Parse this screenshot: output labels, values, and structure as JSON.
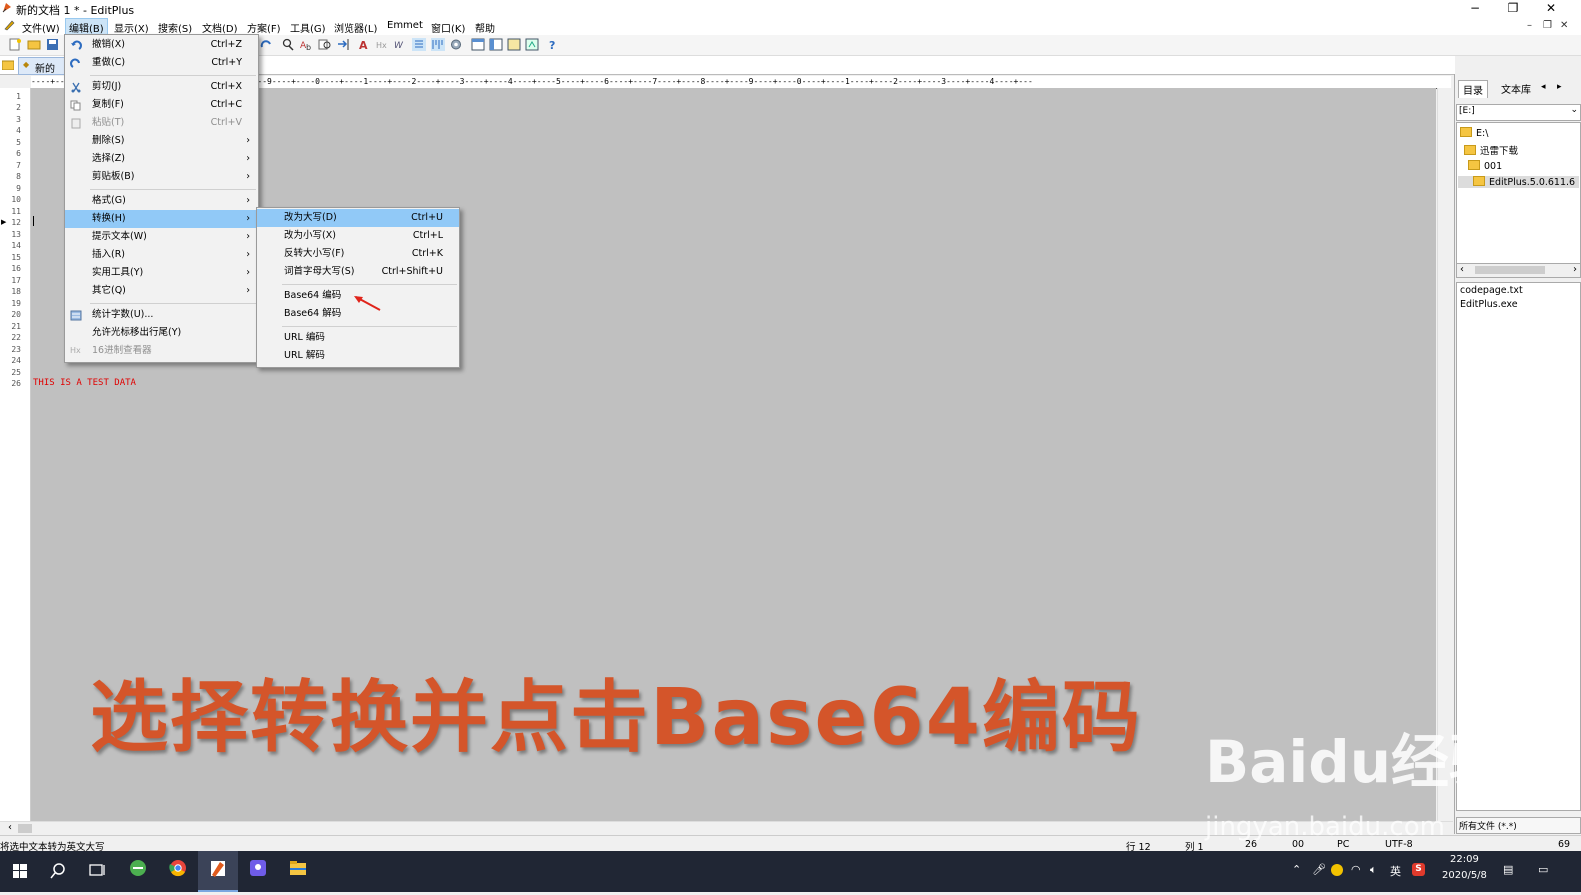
{
  "window": {
    "title": "新的文档 1 * - EditPlus",
    "min": "−",
    "max": "❐",
    "close": "✕"
  },
  "menubar": [
    "文件(W)",
    "编辑(B)",
    "显示(X)",
    "搜索(S)",
    "文档(D)",
    "方案(F)",
    "工具(G)",
    "浏览器(L)",
    "Emmet",
    "窗口(K)",
    "帮助"
  ],
  "mdi": {
    "min": "–",
    "restore": "❐",
    "close": "✕"
  },
  "tabs": [
    {
      "label": "新的"
    }
  ],
  "ruler": "----+----5----+----6----+----7----+----8----+----9----+----0----+----1----+----2----+----3----+----4----+----5----+----6----+----7----+----8----+----9----+----0----+----1----+----2----+----3----+----4----+---",
  "editor": {
    "line_numbers": [
      "1",
      "2",
      "3",
      "4",
      "5",
      "6",
      "7",
      "8",
      "9",
      "10",
      "11",
      "12",
      "13",
      "14",
      "15",
      "16",
      "17",
      "18",
      "19",
      "20",
      "21",
      "22",
      "23",
      "24",
      "25",
      "26"
    ],
    "text": "THIS IS A TEST DATA"
  },
  "edit_menu": [
    {
      "label": "撤销(X)",
      "key": "Ctrl+Z",
      "icon": "undo-icon"
    },
    {
      "label": "重做(C)",
      "key": "Ctrl+Y",
      "icon": "redo-icon"
    },
    {
      "sep": true
    },
    {
      "label": "剪切(J)",
      "key": "Ctrl+X",
      "icon": "cut-icon"
    },
    {
      "label": "复制(F)",
      "key": "Ctrl+C",
      "icon": "copy-icon"
    },
    {
      "label": "粘贴(T)",
      "key": "Ctrl+V",
      "icon": "paste-icon",
      "disabled": true
    },
    {
      "label": "删除(S)",
      "arrow": "›"
    },
    {
      "label": "选择(Z)",
      "arrow": "›"
    },
    {
      "label": "剪贴板(B)",
      "arrow": "›"
    },
    {
      "sep": true
    },
    {
      "label": "格式(G)",
      "arrow": "›"
    },
    {
      "label": "转换(H)",
      "arrow": "›",
      "highlight": true
    },
    {
      "label": "提示文本(W)",
      "arrow": "›"
    },
    {
      "label": "插入(R)",
      "arrow": "›"
    },
    {
      "label": "实用工具(Y)",
      "arrow": "›"
    },
    {
      "label": "其它(Q)",
      "arrow": "›"
    },
    {
      "sep": true
    },
    {
      "label": "统计字数(U)...",
      "icon": "stats-icon"
    },
    {
      "label": "允许光标移出行尾(Y)"
    },
    {
      "label": "16进制查看器",
      "icon": "hex-icon",
      "disabled": true
    }
  ],
  "convert_menu": [
    {
      "label": "改为大写(D)",
      "key": "Ctrl+U",
      "highlight": true
    },
    {
      "label": "改为小写(X)",
      "key": "Ctrl+L"
    },
    {
      "label": "反转大小写(F)",
      "key": "Ctrl+K"
    },
    {
      "label": "词首字母大写(S)",
      "key": "Ctrl+Shift+U"
    },
    {
      "sep": true
    },
    {
      "label": "Base64 编码"
    },
    {
      "label": "Base64 解码"
    },
    {
      "sep": true
    },
    {
      "label": "URL 编码"
    },
    {
      "label": "URL 解码"
    }
  ],
  "right_panel": {
    "tabs": [
      "目录",
      "文本库"
    ],
    "drive": "[E:]",
    "tree": [
      "E:\\",
      "迅雷下载",
      "001",
      "EditPlus.5.0.611.6"
    ],
    "files": [
      "codepage.txt",
      "EditPlus.exe"
    ],
    "filter": "所有文件 (*.*)"
  },
  "status": {
    "message": "将选中文本转为英文大写",
    "line": "行 12",
    "col": "列 1",
    "num1": "26",
    "num2": "00",
    "eol": "PC",
    "encoding": "UTF-8",
    "extra": "69"
  },
  "taskbar": {
    "time": "22:09",
    "date": "2020/5/8",
    "ime": "英"
  },
  "overlay": {
    "caption": "选择转换并点击Base64编码",
    "watermark": "Baidu经验",
    "watermark_url": "jingyan.baidu.com"
  },
  "colors": {
    "caption": "#d4552a",
    "highlight": "#91c9f7",
    "editor_bg": "#c0c0c0",
    "text_red": "#e00000"
  }
}
